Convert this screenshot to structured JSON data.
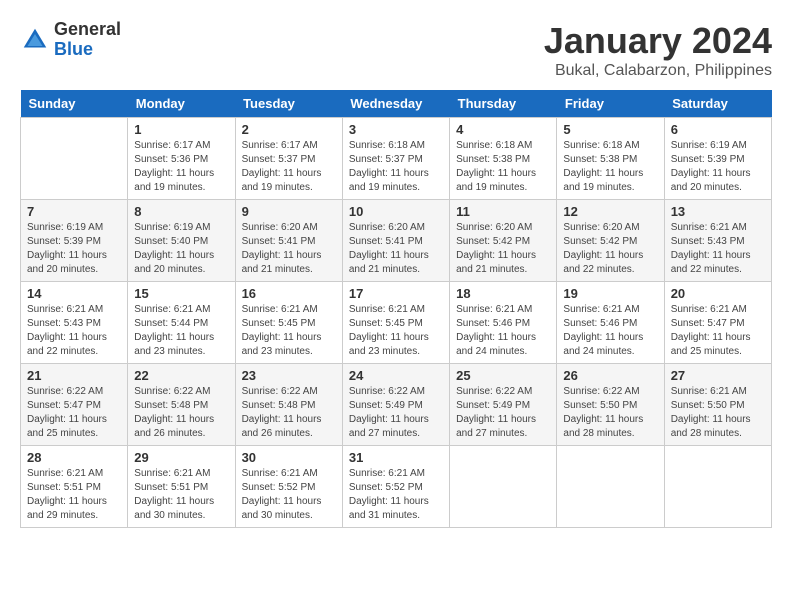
{
  "logo": {
    "general": "General",
    "blue": "Blue"
  },
  "title": "January 2024",
  "subtitle": "Bukal, Calabarzon, Philippines",
  "days_header": [
    "Sunday",
    "Monday",
    "Tuesday",
    "Wednesday",
    "Thursday",
    "Friday",
    "Saturday"
  ],
  "weeks": [
    [
      {
        "day": "",
        "sunrise": "",
        "sunset": "",
        "daylight": ""
      },
      {
        "day": "1",
        "sunrise": "Sunrise: 6:17 AM",
        "sunset": "Sunset: 5:36 PM",
        "daylight": "Daylight: 11 hours and 19 minutes."
      },
      {
        "day": "2",
        "sunrise": "Sunrise: 6:17 AM",
        "sunset": "Sunset: 5:37 PM",
        "daylight": "Daylight: 11 hours and 19 minutes."
      },
      {
        "day": "3",
        "sunrise": "Sunrise: 6:18 AM",
        "sunset": "Sunset: 5:37 PM",
        "daylight": "Daylight: 11 hours and 19 minutes."
      },
      {
        "day": "4",
        "sunrise": "Sunrise: 6:18 AM",
        "sunset": "Sunset: 5:38 PM",
        "daylight": "Daylight: 11 hours and 19 minutes."
      },
      {
        "day": "5",
        "sunrise": "Sunrise: 6:18 AM",
        "sunset": "Sunset: 5:38 PM",
        "daylight": "Daylight: 11 hours and 19 minutes."
      },
      {
        "day": "6",
        "sunrise": "Sunrise: 6:19 AM",
        "sunset": "Sunset: 5:39 PM",
        "daylight": "Daylight: 11 hours and 20 minutes."
      }
    ],
    [
      {
        "day": "7",
        "sunrise": "Sunrise: 6:19 AM",
        "sunset": "Sunset: 5:39 PM",
        "daylight": "Daylight: 11 hours and 20 minutes."
      },
      {
        "day": "8",
        "sunrise": "Sunrise: 6:19 AM",
        "sunset": "Sunset: 5:40 PM",
        "daylight": "Daylight: 11 hours and 20 minutes."
      },
      {
        "day": "9",
        "sunrise": "Sunrise: 6:20 AM",
        "sunset": "Sunset: 5:41 PM",
        "daylight": "Daylight: 11 hours and 21 minutes."
      },
      {
        "day": "10",
        "sunrise": "Sunrise: 6:20 AM",
        "sunset": "Sunset: 5:41 PM",
        "daylight": "Daylight: 11 hours and 21 minutes."
      },
      {
        "day": "11",
        "sunrise": "Sunrise: 6:20 AM",
        "sunset": "Sunset: 5:42 PM",
        "daylight": "Daylight: 11 hours and 21 minutes."
      },
      {
        "day": "12",
        "sunrise": "Sunrise: 6:20 AM",
        "sunset": "Sunset: 5:42 PM",
        "daylight": "Daylight: 11 hours and 22 minutes."
      },
      {
        "day": "13",
        "sunrise": "Sunrise: 6:21 AM",
        "sunset": "Sunset: 5:43 PM",
        "daylight": "Daylight: 11 hours and 22 minutes."
      }
    ],
    [
      {
        "day": "14",
        "sunrise": "Sunrise: 6:21 AM",
        "sunset": "Sunset: 5:43 PM",
        "daylight": "Daylight: 11 hours and 22 minutes."
      },
      {
        "day": "15",
        "sunrise": "Sunrise: 6:21 AM",
        "sunset": "Sunset: 5:44 PM",
        "daylight": "Daylight: 11 hours and 23 minutes."
      },
      {
        "day": "16",
        "sunrise": "Sunrise: 6:21 AM",
        "sunset": "Sunset: 5:45 PM",
        "daylight": "Daylight: 11 hours and 23 minutes."
      },
      {
        "day": "17",
        "sunrise": "Sunrise: 6:21 AM",
        "sunset": "Sunset: 5:45 PM",
        "daylight": "Daylight: 11 hours and 23 minutes."
      },
      {
        "day": "18",
        "sunrise": "Sunrise: 6:21 AM",
        "sunset": "Sunset: 5:46 PM",
        "daylight": "Daylight: 11 hours and 24 minutes."
      },
      {
        "day": "19",
        "sunrise": "Sunrise: 6:21 AM",
        "sunset": "Sunset: 5:46 PM",
        "daylight": "Daylight: 11 hours and 24 minutes."
      },
      {
        "day": "20",
        "sunrise": "Sunrise: 6:21 AM",
        "sunset": "Sunset: 5:47 PM",
        "daylight": "Daylight: 11 hours and 25 minutes."
      }
    ],
    [
      {
        "day": "21",
        "sunrise": "Sunrise: 6:22 AM",
        "sunset": "Sunset: 5:47 PM",
        "daylight": "Daylight: 11 hours and 25 minutes."
      },
      {
        "day": "22",
        "sunrise": "Sunrise: 6:22 AM",
        "sunset": "Sunset: 5:48 PM",
        "daylight": "Daylight: 11 hours and 26 minutes."
      },
      {
        "day": "23",
        "sunrise": "Sunrise: 6:22 AM",
        "sunset": "Sunset: 5:48 PM",
        "daylight": "Daylight: 11 hours and 26 minutes."
      },
      {
        "day": "24",
        "sunrise": "Sunrise: 6:22 AM",
        "sunset": "Sunset: 5:49 PM",
        "daylight": "Daylight: 11 hours and 27 minutes."
      },
      {
        "day": "25",
        "sunrise": "Sunrise: 6:22 AM",
        "sunset": "Sunset: 5:49 PM",
        "daylight": "Daylight: 11 hours and 27 minutes."
      },
      {
        "day": "26",
        "sunrise": "Sunrise: 6:22 AM",
        "sunset": "Sunset: 5:50 PM",
        "daylight": "Daylight: 11 hours and 28 minutes."
      },
      {
        "day": "27",
        "sunrise": "Sunrise: 6:21 AM",
        "sunset": "Sunset: 5:50 PM",
        "daylight": "Daylight: 11 hours and 28 minutes."
      }
    ],
    [
      {
        "day": "28",
        "sunrise": "Sunrise: 6:21 AM",
        "sunset": "Sunset: 5:51 PM",
        "daylight": "Daylight: 11 hours and 29 minutes."
      },
      {
        "day": "29",
        "sunrise": "Sunrise: 6:21 AM",
        "sunset": "Sunset: 5:51 PM",
        "daylight": "Daylight: 11 hours and 30 minutes."
      },
      {
        "day": "30",
        "sunrise": "Sunrise: 6:21 AM",
        "sunset": "Sunset: 5:52 PM",
        "daylight": "Daylight: 11 hours and 30 minutes."
      },
      {
        "day": "31",
        "sunrise": "Sunrise: 6:21 AM",
        "sunset": "Sunset: 5:52 PM",
        "daylight": "Daylight: 11 hours and 31 minutes."
      },
      {
        "day": "",
        "sunrise": "",
        "sunset": "",
        "daylight": ""
      },
      {
        "day": "",
        "sunrise": "",
        "sunset": "",
        "daylight": ""
      },
      {
        "day": "",
        "sunrise": "",
        "sunset": "",
        "daylight": ""
      }
    ]
  ]
}
